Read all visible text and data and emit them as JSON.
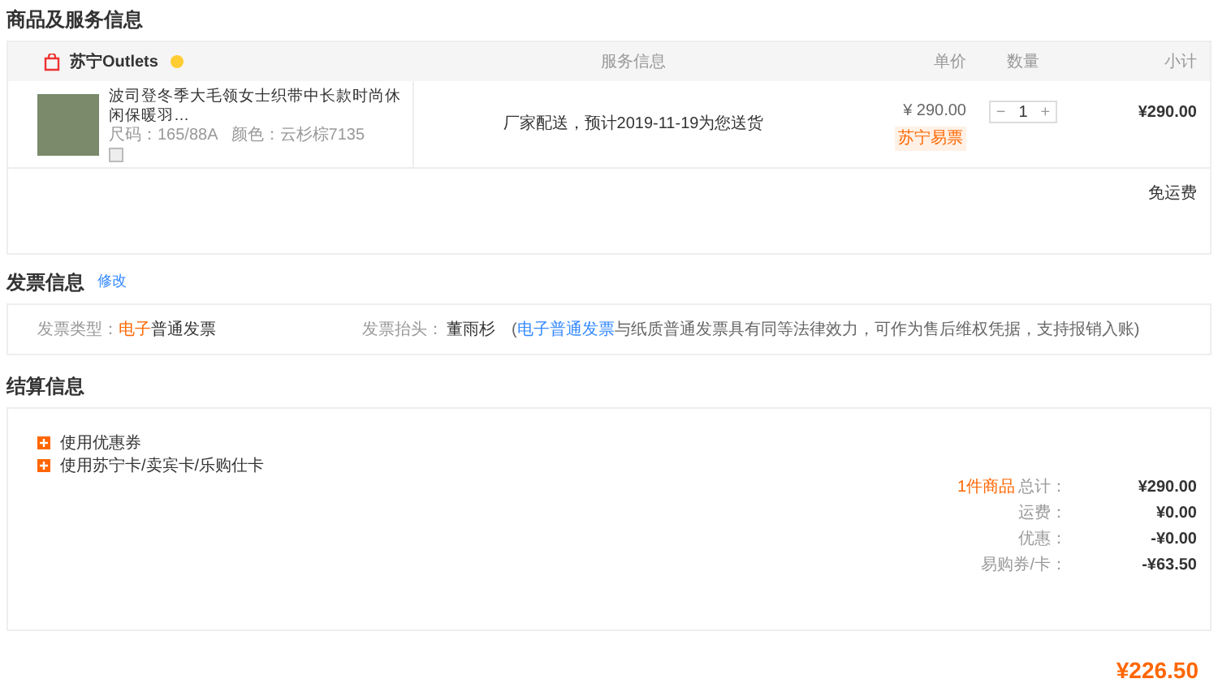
{
  "goods_section": {
    "title": "商品及服务信息",
    "store": {
      "name": "苏宁Outlets"
    },
    "columns": [
      "服务信息",
      "单价",
      "数量",
      "小计"
    ],
    "item": {
      "name": "波司登冬季大毛领女士织带中长款时尚休闲保暖羽…",
      "spec_size": "尺码：165/88A",
      "spec_color": "颜色：云杉棕7135",
      "service": "厂家配送，预计2019-11-19为您送货",
      "price": "¥ 290.00",
      "price_tag": "苏宁易票",
      "quantity": "1",
      "minus": "−",
      "plus": "+",
      "subtotal": "¥290.00"
    },
    "shipping": "免运费"
  },
  "invoice_section": {
    "title": "发票信息",
    "edit_link": "修改",
    "type_label": "发票类型：",
    "type_highlight": "电子",
    "type_rest": "普通发票",
    "header_label": "发票抬头：",
    "header_value": "董雨杉",
    "note_open": "(",
    "note_link": "电子普通发票",
    "note_rest": "与纸质普通发票具有同等法律效力，可作为售后维权凭据，支持报销入账)"
  },
  "settlement_section": {
    "title": "结算信息",
    "options": [
      {
        "label": "使用优惠券"
      },
      {
        "label": "使用苏宁卡/卖宾卡/乐购仕卡"
      }
    ],
    "summary": [
      {
        "label": "总计：",
        "count": "1件商品",
        "value": "¥290.00"
      },
      {
        "label": "运费：",
        "value": "¥0.00"
      },
      {
        "label": "优惠：",
        "value": "-¥0.00"
      },
      {
        "label": "易购券/卡：",
        "value": "-¥63.50"
      }
    ]
  },
  "payable": "¥226.50"
}
